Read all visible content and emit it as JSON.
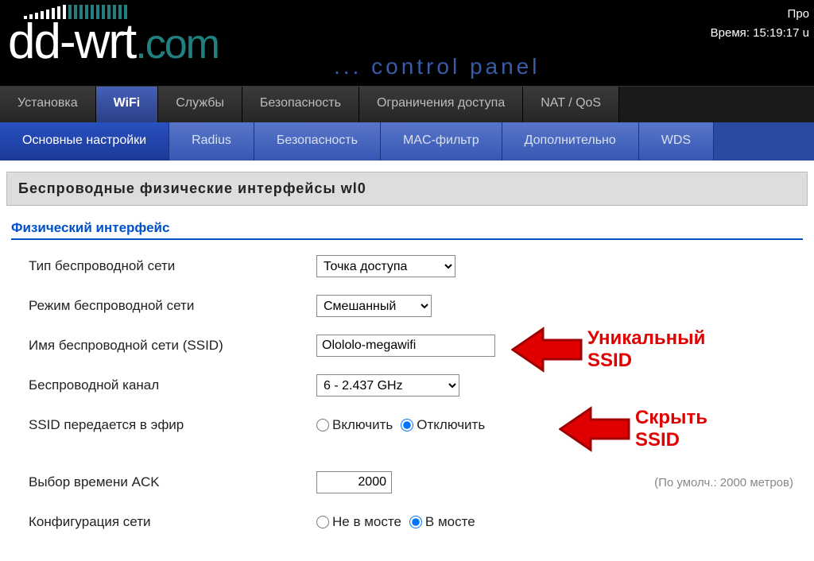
{
  "header": {
    "logo_1": "dd-wrt",
    "logo_2": ".com",
    "control_panel": "... control panel",
    "top_right_1": "Про",
    "top_right_2": "Время: 15:19:17 u"
  },
  "main_tabs": [
    {
      "label": "Установка",
      "active": false
    },
    {
      "label": "WiFi",
      "active": true
    },
    {
      "label": "Службы",
      "active": false
    },
    {
      "label": "Безопасность",
      "active": false
    },
    {
      "label": "Ограничения доступа",
      "active": false
    },
    {
      "label": "NAT / QoS",
      "active": false
    }
  ],
  "sub_tabs": [
    {
      "label": "Основные настройки",
      "active": true
    },
    {
      "label": "Radius",
      "active": false
    },
    {
      "label": "Безопасность",
      "active": false
    },
    {
      "label": "MAC-фильтр",
      "active": false
    },
    {
      "label": "Дополнительно",
      "active": false
    },
    {
      "label": "WDS",
      "active": false
    }
  ],
  "section": {
    "title": "Беспроводные физические интерфейсы wl0",
    "subtitle": "Физический интерфейс"
  },
  "form": {
    "wireless_type": {
      "label": "Тип беспроводной сети",
      "value": "Точка доступа"
    },
    "wireless_mode": {
      "label": "Режим беспроводной сети",
      "value": "Смешанный"
    },
    "ssid": {
      "label": "Имя беспроводной сети (SSID)",
      "value": "Olololo-megawifi"
    },
    "channel": {
      "label": "Беспроводной канал",
      "value": "6 - 2.437 GHz"
    },
    "broadcast": {
      "label": "SSID передается в эфир",
      "on": "Включить",
      "off": "Отключить"
    },
    "ack": {
      "label": "Выбор времени ACK",
      "value": "2000",
      "hint": "(По умолч.: 2000 метров)"
    },
    "netconfig": {
      "label": "Конфигурация сети",
      "a": "Не в мосте",
      "b": "В мосте"
    }
  },
  "annotations": {
    "unique_ssid": "Уникальный\nSSID",
    "hide_ssid": "Скрыть\nSSID"
  }
}
